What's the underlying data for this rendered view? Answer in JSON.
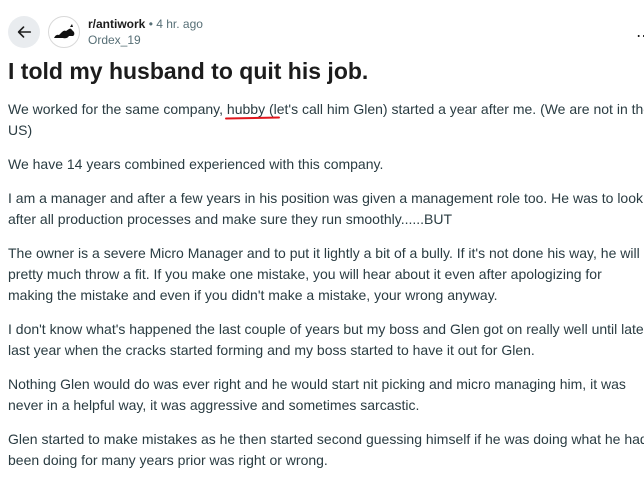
{
  "post": {
    "subreddit": "r/antiwork",
    "separator": "•",
    "time_ago": "4 hr. ago",
    "author": "Ordex_19",
    "more_label": "⋯",
    "title": "I told my husband to quit his job.",
    "p1": {
      "before": "We worked for the same company, ",
      "highlight": "hubby (",
      "after": "let's call him Glen) started a year after me. (We are not in the",
      "line2": "US)"
    },
    "p2": "We have 14 years combined experienced with this company.",
    "p3": {
      "line1": "I am a manager and after a few years in his position was given a management role too. He was to look",
      "line2": "after all production processes and make sure they run smoothly......BUT"
    },
    "p4": {
      "line1": "The owner is a severe Micro Manager and to put it lightly a bit of a bully. If it's not done his way, he will",
      "line2": "pretty much throw a fit. If you make one mistake, you will hear about it even after apologizing for",
      "line3": "making the mistake and even if you didn't make a mistake, your wrong anyway."
    },
    "p5": {
      "line1": "I don't know what's happened the last couple of years but my boss and Glen got on really well until late",
      "line2": "last year when the cracks started forming and my boss started to have it out for Glen."
    },
    "p6": {
      "line1": "Nothing Glen would do was ever right and he would start nit picking and micro managing him, it was",
      "line2": "never in a helpful way, it was aggressive and sometimes sarcastic."
    },
    "p7": {
      "line1": "Glen started to make mistakes as he then started second guessing himself if he was doing what he had",
      "line2": "been doing for many years prior was right or wrong."
    }
  },
  "colors": {
    "annotation_underline": "#e0161d",
    "back_button_bg": "#e9ecef",
    "meta_text": "#576f76"
  },
  "icons": {
    "back": "arrow-left-icon",
    "avatar": "subreddit-avatar-icon",
    "more": "more-options-icon"
  }
}
